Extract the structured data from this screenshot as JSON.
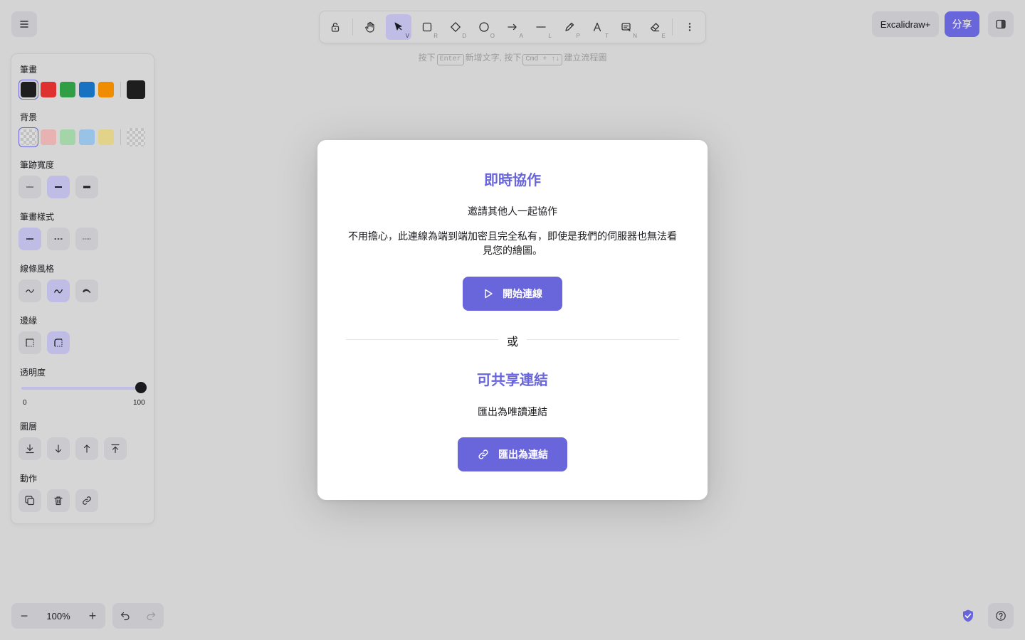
{
  "toolbar": {
    "tools": [
      {
        "name": "lock",
        "key": ""
      },
      {
        "name": "hand",
        "key": ""
      },
      {
        "name": "selection",
        "key": "V"
      },
      {
        "name": "rectangle",
        "key": "R"
      },
      {
        "name": "diamond",
        "key": "D"
      },
      {
        "name": "ellipse",
        "key": "O"
      },
      {
        "name": "arrow",
        "key": "A"
      },
      {
        "name": "line",
        "key": "L"
      },
      {
        "name": "draw",
        "key": "P"
      },
      {
        "name": "text",
        "key": "T"
      },
      {
        "name": "image",
        "key": "N"
      },
      {
        "name": "eraser",
        "key": "E"
      }
    ],
    "active_tool": "selection"
  },
  "hint": {
    "part1": "按下",
    "key1": "Enter",
    "part2": "新增文字, 按下",
    "key2": "Cmd + ↑↓",
    "part3": "建立流程圖"
  },
  "topright": {
    "plus_label": "Excalidraw+",
    "share_label": "分享"
  },
  "panel": {
    "stroke_title": "筆畫",
    "stroke_colors": [
      "#1e1e1e",
      "#e03131",
      "#2f9e44",
      "#1971c2",
      "#f08c00"
    ],
    "stroke_current": "#1e1e1e",
    "background_title": "背景",
    "background_colors": [
      "transparent",
      "#ffc9c9",
      "#b2f2bb",
      "#a5d8ff",
      "#ffec99"
    ],
    "stroke_width_title": "筆跡寬度",
    "stroke_style_title": "筆畫樣式",
    "sloppiness_title": "線條風格",
    "edges_title": "邊緣",
    "opacity_title": "透明度",
    "opacity_min": "0",
    "opacity_max": "100",
    "opacity_value": 100,
    "layers_title": "圖層",
    "actions_title": "動作"
  },
  "zoom": {
    "value": "100%",
    "minus": "−",
    "plus": "+"
  },
  "modal": {
    "live_title": "即時協作",
    "live_subtitle": "邀請其他人一起協作",
    "live_description": "不用擔心，此連線為端到端加密且完全私有，即使是我們的伺服器也無法看見您的繪圖。",
    "start_button": "開始連線",
    "or_label": "或",
    "link_title": "可共享連結",
    "link_subtitle": "匯出為唯讀連結",
    "export_button": "匯出為連結"
  },
  "colors": {
    "accent": "#6965db",
    "accent_light": "#bfbde6"
  }
}
